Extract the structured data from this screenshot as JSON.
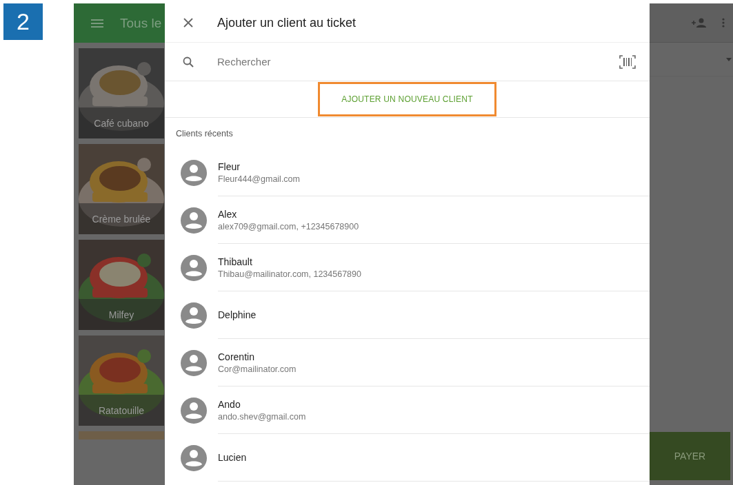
{
  "step_badge": "2",
  "background_app": {
    "toolbar_title": "Tous le",
    "tiles": [
      {
        "label": "Café cubano"
      },
      {
        "label": "Crème brulée"
      },
      {
        "label": "Milfey"
      },
      {
        "label": "Ratatouille"
      }
    ],
    "pay_button": "PAYER"
  },
  "dialog": {
    "title": "Ajouter un client au ticket",
    "search": {
      "placeholder": "Rechercher"
    },
    "add_button": {
      "label": "AJOUTER UN NOUVEAU CLIENT",
      "highlighted": true
    },
    "section_label": "Clients récents",
    "clients": [
      {
        "name": "Fleur",
        "contact": "Fleur444@gmail.com"
      },
      {
        "name": "Alex",
        "contact": "alex709@gmail.com, +12345678900"
      },
      {
        "name": "Thibault",
        "contact": "Thibau@mailinator.com, 1234567890"
      },
      {
        "name": "Delphine"
      },
      {
        "name": "Corentin",
        "contact": "Cor@mailinator.com"
      },
      {
        "name": "Ando",
        "contact": "ando.shev@gmail.com"
      },
      {
        "name": "Lucien"
      }
    ]
  }
}
